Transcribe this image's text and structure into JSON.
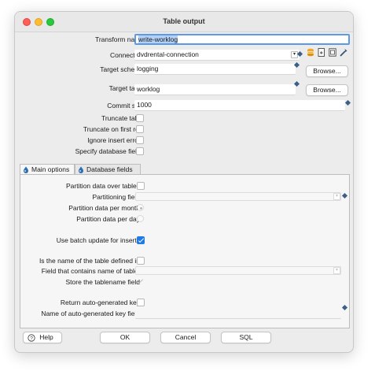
{
  "window": {
    "title": "Table output"
  },
  "form": {
    "transform_name_label": "Transform name",
    "transform_name_value": "write-worklog",
    "connection_label": "Connection",
    "connection_value": "dvdrental-connection",
    "target_schema_label": "Target schema",
    "target_schema_value": "logging",
    "target_table_label": "Target table",
    "target_table_value": "worklog",
    "browse_label": "Browse...",
    "commit_size_label": "Commit size",
    "commit_size_value": "1000",
    "truncate_table_label": "Truncate table",
    "truncate_first_row_label": "Truncate on first row",
    "ignore_errors_label": "Ignore insert errors",
    "specify_fields_label": "Specify database fields"
  },
  "tabs": [
    {
      "label": "Main options",
      "active": true
    },
    {
      "label": "Database fields",
      "active": false
    }
  ],
  "main_options": {
    "partition_label": "Partition data over tables",
    "partitioning_field_label": "Partitioning field",
    "per_month_label": "Partition data per month",
    "per_day_label": "Partition data per day",
    "batch_update_label": "Use batch update for inserts",
    "batch_update_checked": true,
    "name_in_field_label": "Is the name of the table defined in",
    "field_contains_label": "Field that contains name of table:",
    "store_tablename_label": "Store the tablename field",
    "return_key_label": "Return auto-generated key",
    "key_field_label": "Name of auto-generated key field"
  },
  "buttons": {
    "help": "Help",
    "ok": "OK",
    "cancel": "Cancel",
    "sql": "SQL"
  },
  "colors": {
    "accent": "#1f7ae8",
    "focus_ring": "#5b9ae8",
    "variable_diamond": "#3b5f86"
  }
}
